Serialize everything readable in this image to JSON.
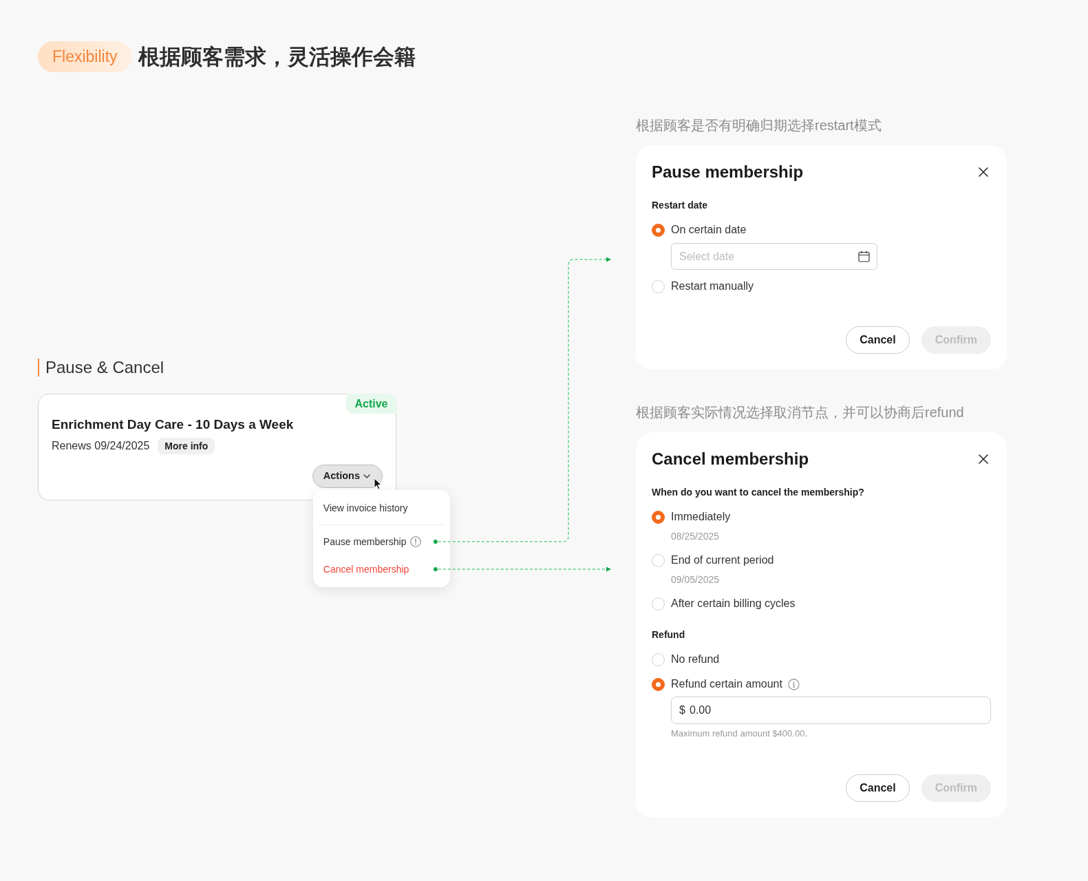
{
  "header": {
    "badge": "Flexibility",
    "title": "根据顾客需求，灵活操作会籍"
  },
  "section": {
    "title": "Pause & Cancel"
  },
  "membership_card": {
    "status": "Active",
    "title": "Enrichment Day Care - 10 Days a Week",
    "renewal": "Renews 09/24/2025",
    "more_info": "More info",
    "actions": {
      "label": "Actions",
      "expanded": true,
      "menu_groups": [
        {
          "items": [
            {
              "label": "View invoice history",
              "kind": "plain",
              "linked": false
            }
          ]
        },
        {
          "items": [
            {
              "label": "Pause membership",
              "kind": "warning",
              "linked": true
            },
            {
              "label": "Cancel membership",
              "kind": "danger",
              "linked": true
            }
          ]
        }
      ]
    }
  },
  "dialogs": [
    {
      "caption": "根据顾客是否有明确归期选择restart模式",
      "title": "Pause membership",
      "sections": [
        {
          "label": "Restart date",
          "options": [
            {
              "label": "On certain date",
              "selected": true,
              "date_field": {
                "placeholder": "Select date"
              }
            },
            {
              "label": "Restart manually",
              "selected": false
            }
          ]
        }
      ],
      "buttons": [
        {
          "label": "Cancel",
          "kind": "outline",
          "disabled": false
        },
        {
          "label": "Confirm",
          "kind": "primary",
          "disabled": true
        }
      ]
    },
    {
      "caption": "根据顾客实际情况选择取消节点，并可以协商后refund",
      "title": "Cancel membership",
      "sections": [
        {
          "label": "When do you want to cancel the membership?",
          "options": [
            {
              "label": "Immediately",
              "selected": true,
              "note": "08/25/2025"
            },
            {
              "label": "End of current period",
              "selected": false,
              "note": "09/05/2025"
            },
            {
              "label": "After certain billing cycles",
              "selected": false
            }
          ]
        },
        {
          "label": "Refund",
          "options": [
            {
              "label": "No refund",
              "selected": false
            },
            {
              "label": "Refund certain amount",
              "selected": true,
              "info": true,
              "amount_field": {
                "prefix": "$",
                "value": "0.00",
                "hint": "Maximum refund amount $400.00."
              }
            }
          ]
        }
      ],
      "buttons": [
        {
          "label": "Cancel",
          "kind": "outline",
          "disabled": false
        },
        {
          "label": "Confirm",
          "kind": "primary",
          "disabled": true
        }
      ]
    }
  ]
}
